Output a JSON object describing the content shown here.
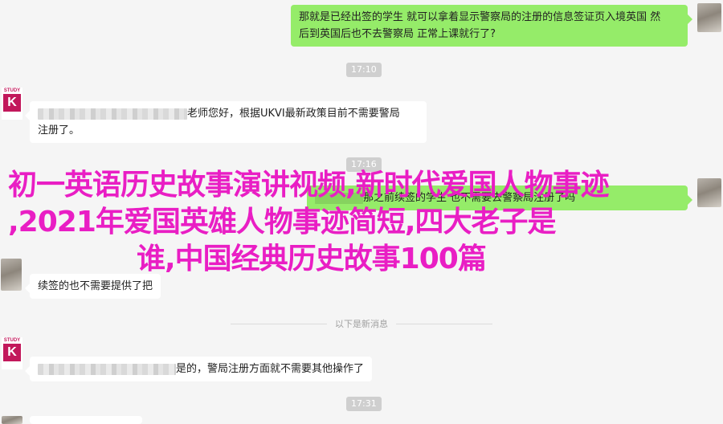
{
  "messages": {
    "m1": "那就是已经出签的学生 就可以拿着显示警察局的注册的信息签证页入境英国 然",
    "m1b": "后到英国后也不去警察局 正常上课就行了?",
    "m2": "老师您好，根据UKVI最新政策目前不需要警局",
    "m2b": "注册了。",
    "m3": "那之前续签的学生 也不需要去警察局注册了吗",
    "m4": "续签的也不需要提供了把",
    "m5": "是的，警局注册方面就不需要其他操作了"
  },
  "times": {
    "t1": "17:10",
    "t2": "17:16",
    "t3": "17:31"
  },
  "divider": "以下是新消息",
  "avatar": {
    "brand_top": "STUDY",
    "brand_letter": "K"
  },
  "headline": {
    "line1": "初一英语历史故事演讲视频,新时代爱国人物事迹",
    "line2": ",2021年爱国英雄人物事迹简短,四大老子是",
    "line3": "谁,中国经典历史故事100篇"
  },
  "colors": {
    "incoming": "#ffffff",
    "outgoing": "#95ec69",
    "headline": "#e91ec4",
    "brand": "#c2185b"
  }
}
